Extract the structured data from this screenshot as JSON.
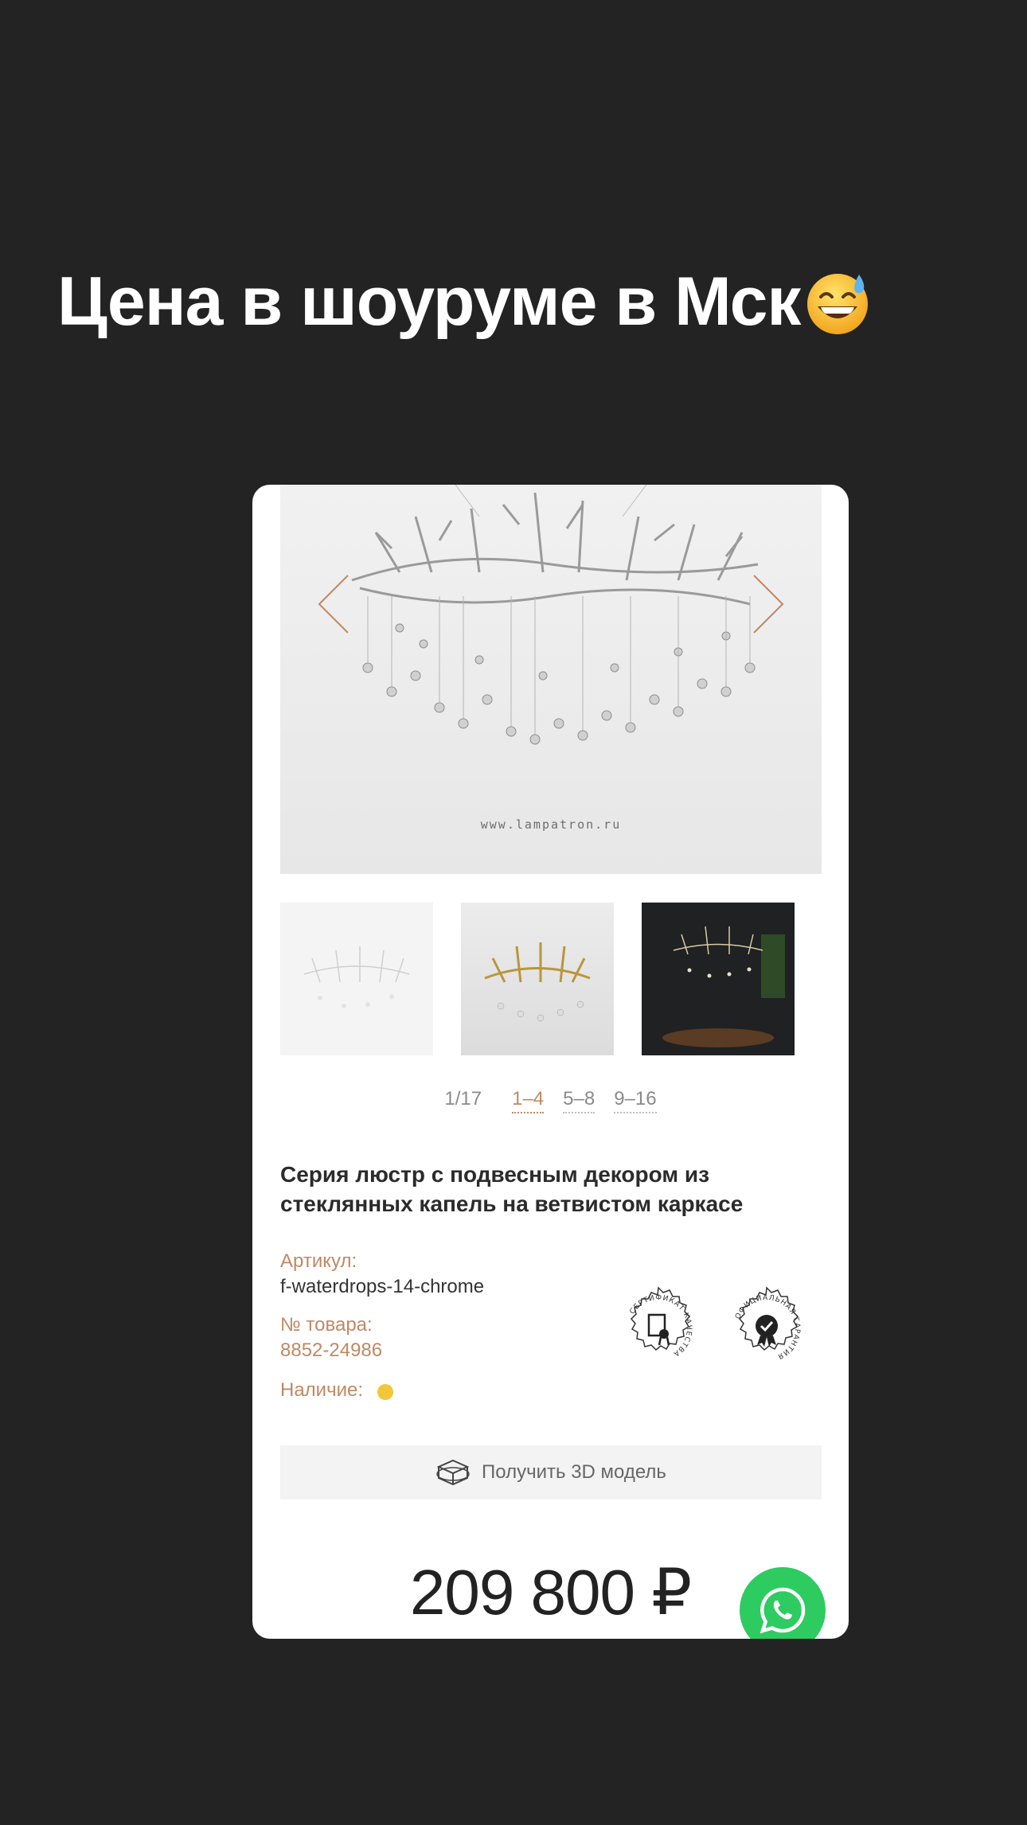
{
  "headline": {
    "text": "Цена в шоуруме в Мск",
    "emoji": "sweat-smile-emoji"
  },
  "product": {
    "watermark": "www.lampatron.ru",
    "pager": {
      "count": "1/17",
      "pages": [
        "1–4",
        "5–8",
        "9–16"
      ],
      "active_index": 0
    },
    "title": "Серия люстр с подвесным декором из стеклянных капель на ветвистом каркасе",
    "article_label": "Артикул:",
    "article_value": "f-waterdrops-14-chrome",
    "item_no_label": "№ товара:",
    "item_no_value": "8852-24986",
    "availability_label": "Наличие:",
    "availability_color": "#f3c63a",
    "seals": {
      "certificate_text": "СЕРТИФИКАТ КАЧЕСТВА",
      "guarantee_text": "ОФИЦИАЛЬНАЯ ГАРАНТИЯ"
    },
    "model_button_label": "Получить 3D модель",
    "price": "209 800 ₽"
  },
  "colors": {
    "background": "#232323",
    "accent": "#c08864",
    "whatsapp": "#2ecb61"
  },
  "icons": [
    "arrow-left-icon",
    "arrow-right-icon",
    "cube-3d-icon",
    "whatsapp-icon",
    "certificate-seal-icon",
    "guarantee-seal-icon"
  ]
}
